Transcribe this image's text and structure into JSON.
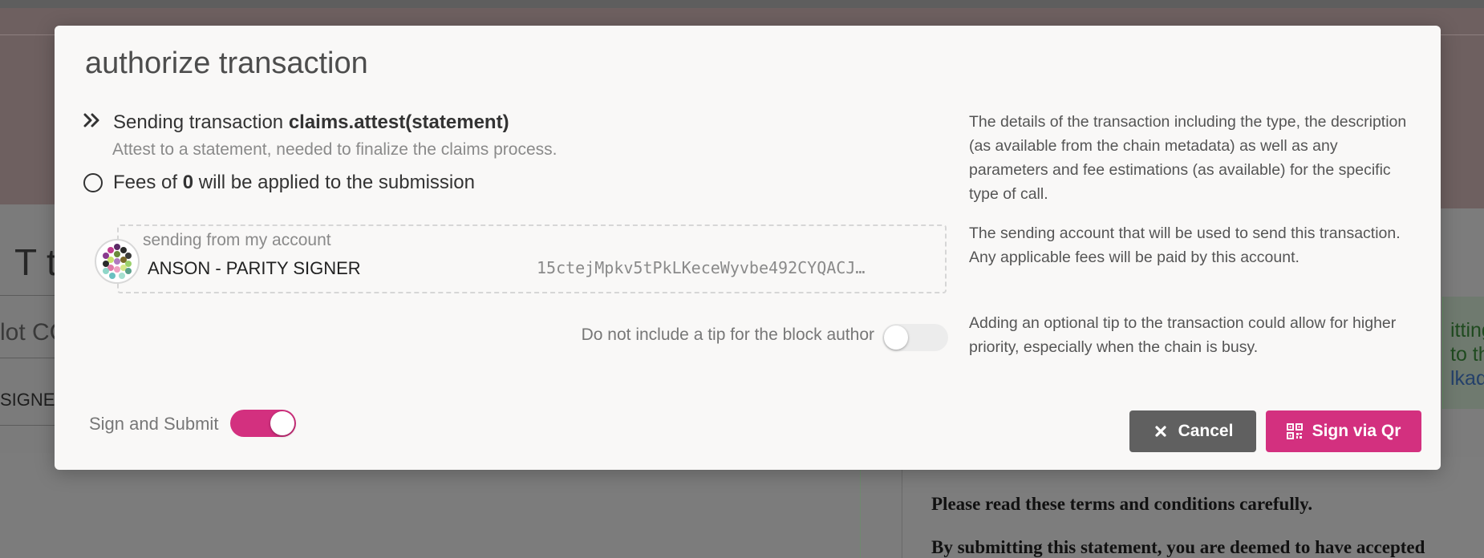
{
  "modal": {
    "title": "authorize transaction",
    "transaction": {
      "prefix": "Sending transaction ",
      "call": "claims.attest(statement)",
      "description": "Attest to a statement, needed to finalize the claims process."
    },
    "fees": {
      "prefix": "Fees of ",
      "amount": "0",
      "suffix": " will be applied to the submission"
    },
    "account": {
      "label": "sending from my account",
      "name": "ANSON - PARITY SIGNER",
      "address": "15ctejMpkv5tPkLKeceWyvbe492CYQACJ…"
    },
    "tip": {
      "label": "Do not include a tip for the block author",
      "enabled": false
    },
    "help": [
      "The details of the transaction including the type, the description (as available from the chain metadata) as well as any parameters and fee estimations (as available) for the specific type of call.",
      "The sending account that will be used to send this transaction. Any applicable fees will be paid by this account.",
      "Adding an optional tip to the transaction could allow for higher priority, especially when the chain is busy."
    ],
    "sign_and_submit": {
      "label": "Sign and Submit",
      "enabled": true
    },
    "buttons": {
      "cancel": "Cancel",
      "sign": "Sign via Qr"
    }
  },
  "background": {
    "heading_fragment": "T tok",
    "input_fragment": "lot CC",
    "signer_fragment": "SIGNE",
    "terms_1": "Please read these terms and conditions carefully.",
    "terms_2": "By submitting this statement, you are deemed to have accepted",
    "notice_1": "itting",
    "notice_2": "to the",
    "notice_link": "lkado"
  },
  "colors": {
    "accent": "#d3307f",
    "cancel": "#606060",
    "modal_bg": "#f9f8f7"
  }
}
